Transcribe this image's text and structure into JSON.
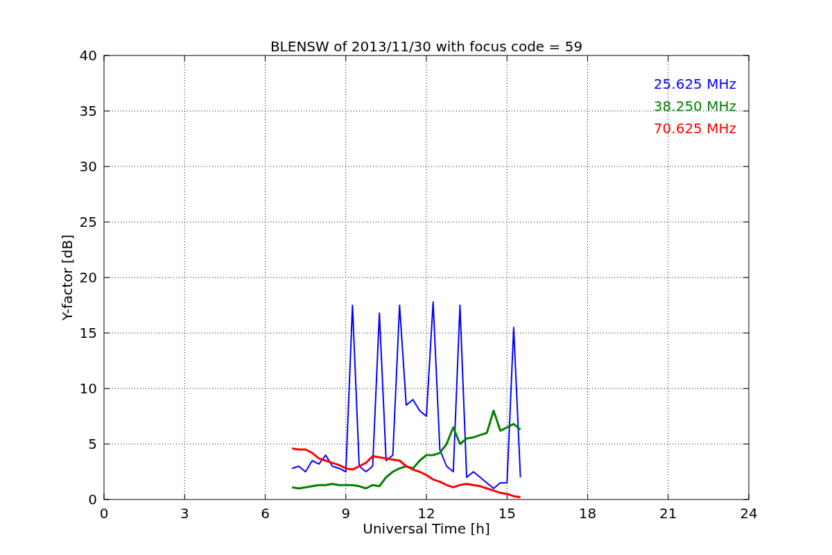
{
  "figure": {
    "chart_data": {
      "type": "line",
      "title": "BLENSW of 2013/11/30 with focus code = 59",
      "xlabel": "Universal Time [h]",
      "ylabel": "Y-factor [dB]",
      "x": [
        7.0,
        7.25,
        7.5,
        7.75,
        8.0,
        8.25,
        8.5,
        8.75,
        9.0,
        9.25,
        9.5,
        9.75,
        10.0,
        10.25,
        10.5,
        10.75,
        11.0,
        11.25,
        11.5,
        11.75,
        12.0,
        12.25,
        12.5,
        12.75,
        13.0,
        13.25,
        13.5,
        13.75,
        14.0,
        14.25,
        14.5,
        14.75,
        15.0,
        15.25,
        15.5
      ],
      "series": [
        {
          "name": "25.625 MHz",
          "color": "#0000ff",
          "values": [
            2.8,
            3.0,
            2.5,
            3.5,
            3.2,
            4.0,
            3.0,
            2.8,
            2.5,
            17.5,
            3.0,
            2.5,
            3.0,
            16.8,
            3.5,
            4.0,
            17.5,
            8.5,
            9.0,
            8.0,
            7.5,
            17.8,
            4.5,
            3.0,
            2.5,
            17.5,
            2.0,
            2.5,
            2.0,
            1.5,
            1.0,
            1.5,
            1.5,
            15.5,
            2.0
          ]
        },
        {
          "name": "38.250 MHz",
          "color": "#008000",
          "values": [
            1.1,
            1.0,
            1.1,
            1.2,
            1.3,
            1.3,
            1.4,
            1.3,
            1.3,
            1.3,
            1.2,
            1.0,
            1.3,
            1.2,
            2.0,
            2.5,
            2.8,
            3.0,
            2.8,
            3.5,
            4.0,
            4.0,
            4.2,
            5.0,
            6.5,
            5.0,
            5.5,
            5.6,
            5.8,
            6.0,
            8.0,
            6.2,
            6.5,
            6.8,
            6.3
          ]
        },
        {
          "name": "70.625 MHz",
          "color": "#ff0000",
          "values": [
            4.6,
            4.5,
            4.5,
            4.2,
            3.7,
            3.5,
            3.3,
            3.1,
            2.8,
            2.7,
            3.0,
            3.3,
            3.9,
            3.8,
            3.7,
            3.6,
            3.5,
            3.0,
            2.7,
            2.5,
            2.2,
            1.8,
            1.6,
            1.3,
            1.1,
            1.3,
            1.4,
            1.3,
            1.2,
            1.0,
            0.8,
            0.6,
            0.5,
            0.3,
            0.2
          ]
        }
      ],
      "grid": true,
      "xlim": [
        0,
        24
      ],
      "ylim": [
        0,
        40
      ],
      "xticks": [
        0,
        3,
        6,
        9,
        12,
        15,
        18,
        21,
        24
      ],
      "yticks": [
        0,
        5,
        10,
        15,
        20,
        25,
        30,
        35,
        40
      ]
    }
  }
}
